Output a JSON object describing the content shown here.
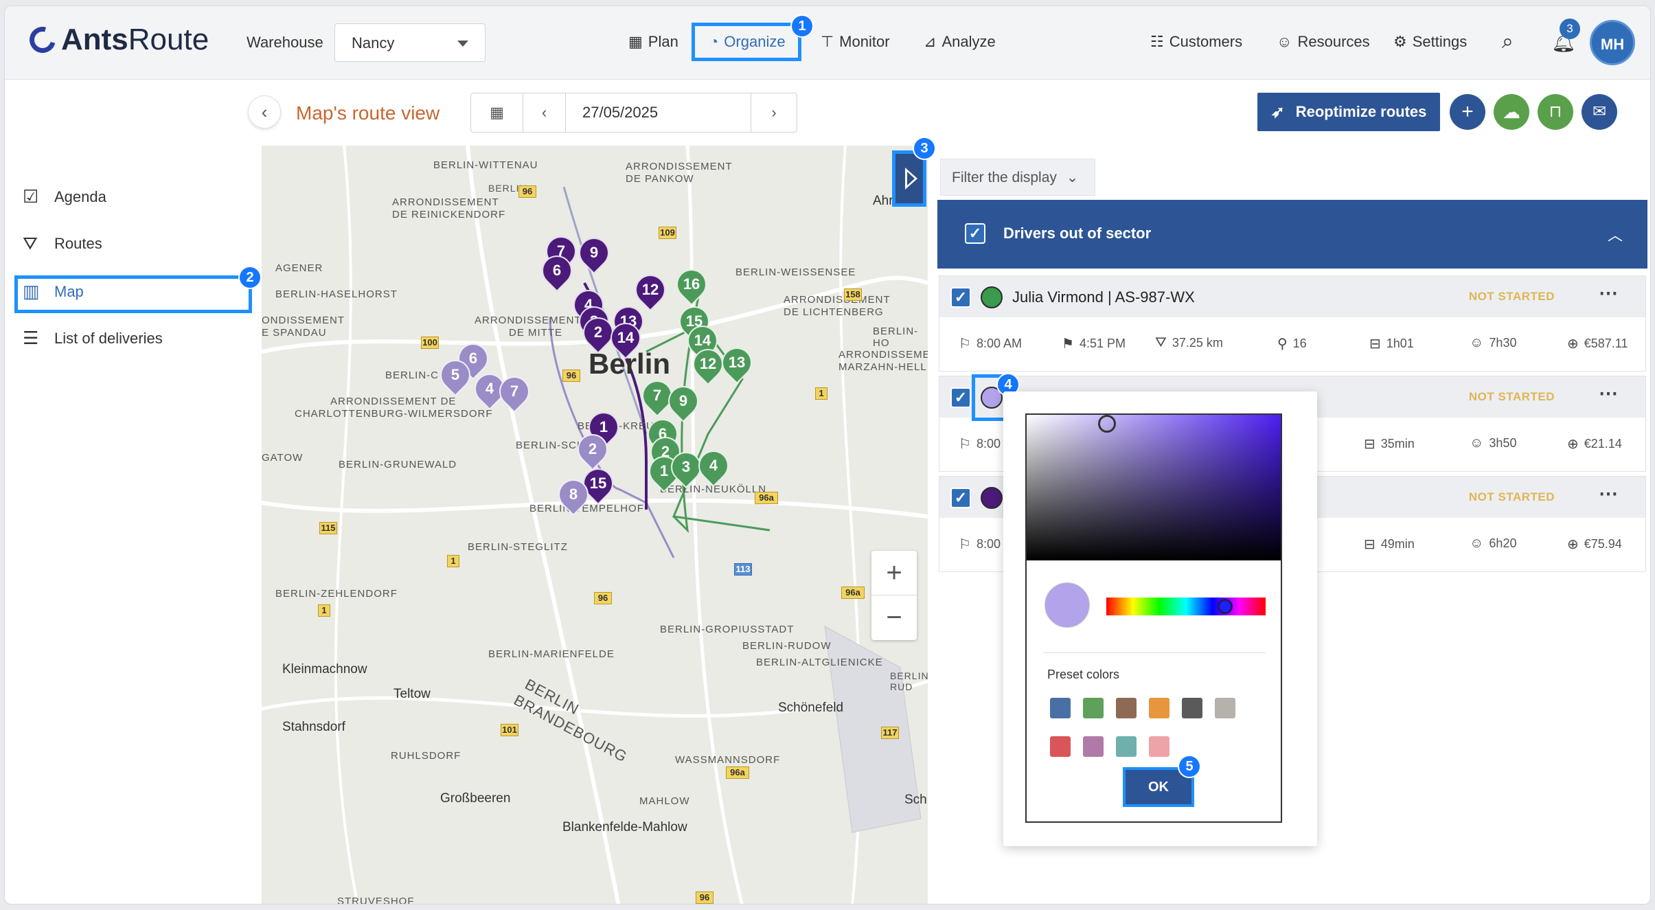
{
  "app": {
    "logo_bold": "Ants",
    "logo_rest": "Route"
  },
  "header": {
    "warehouse_label": "Warehouse",
    "warehouse_value": "Nancy",
    "nav": [
      {
        "label": "Plan",
        "icon": "calendar-icon"
      },
      {
        "label": "Organize",
        "icon": "gauge-icon"
      },
      {
        "label": "Monitor",
        "icon": "signpost-icon"
      },
      {
        "label": "Analyze",
        "icon": "chart-icon"
      },
      {
        "label": "Customers",
        "icon": "people-icon"
      },
      {
        "label": "Resources",
        "icon": "user-gear-icon"
      },
      {
        "label": "Settings",
        "icon": "gear-icon"
      }
    ],
    "notification_count": "3",
    "avatar_initials": "MH"
  },
  "steps": {
    "s1": "1",
    "s2": "2",
    "s3": "3",
    "s4": "4",
    "s5": "5"
  },
  "subheader": {
    "title": "Map's route view",
    "date": "27/05/2025",
    "reoptimize_label": "Reoptimize routes"
  },
  "sidebar": {
    "items": [
      {
        "label": "Agenda",
        "icon": "calendar-check-icon"
      },
      {
        "label": "Routes",
        "icon": "map-fold-icon"
      },
      {
        "label": "Map",
        "icon": "map-icon"
      },
      {
        "label": "List of deliveries",
        "icon": "list-icon"
      }
    ]
  },
  "map": {
    "city": "Berlin",
    "labels": [
      "BERLIN-WITTENAU",
      "ARRONDISSEMENT",
      "DE PANKOW",
      "ARRONDISSEMENT",
      "DE REINICKENDORF",
      "AGENER",
      "BERLIN-HASELHORST",
      "ONDISSEMENT",
      "E SPANDAU",
      "BERLIN-C",
      "ARRONDISSEMENT DE",
      "CHARLOTTENBURG-WILMERSDORF",
      "GATOW",
      "BERLIN-GRUNEWALD",
      "BERLIN-SCHÖN",
      "BERLIN-KREU",
      "BERLIN-NEUKÖLLN",
      "BERLIN-TEMPELHOF",
      "BERLIN-STEGLITZ",
      "BERLIN-ZEHLENDORF",
      "BERLIN-MARIENFELDE",
      "BERLIN-GROPIUSSTADT",
      "BERLIN-RUDOW",
      "BERLIN-ALTGLIENICKE",
      "Kleinmachnow",
      "Teltow",
      "Stahnsdorf",
      "RUHLSDORF",
      "BERLIN",
      "BRANDEBOURG",
      "Schönefeld",
      "WASSMANNSDORF",
      "MAHLOW",
      "Großbeeren",
      "Blankenfelde-Mahlow",
      "STRUVESHOF",
      "BERLIN-WEISSENSEE",
      "ARRONDISSEMENT",
      "DE LICHTENBERG",
      "BERLIN-HO",
      "ARRONDISSEMENT",
      "MARZAHN-HELL",
      "ARRONDISSEMENT",
      "DE MITTE",
      "Ahr",
      "Schu",
      "BERLIN",
      "BERLIN-RUD"
    ],
    "shields": [
      "96",
      "109",
      "158",
      "100",
      "96",
      "1",
      "115",
      "1",
      "96a",
      "113",
      "1",
      "96",
      "96a",
      "101",
      "96a",
      "117",
      "96"
    ],
    "purple_dark_pins": [
      "7",
      "9",
      "6",
      "12",
      "4",
      "3",
      "13",
      "2",
      "14",
      "1",
      "15"
    ],
    "purple_light_pins": [
      "6",
      "5",
      "4",
      "7",
      "2",
      "8"
    ],
    "green_pins": [
      "16",
      "15",
      "14",
      "12",
      "13",
      "7",
      "9",
      "6",
      "2",
      "1",
      "3",
      "4"
    ]
  },
  "panel": {
    "filter_label": "Filter the display",
    "sector_title": "Drivers out of sector",
    "routes": [
      {
        "name": "Julia Virmond | AS-987-WX",
        "status": "NOT STARTED",
        "color": "#3a9a4e",
        "stats": [
          "8:00 AM",
          "4:51 PM",
          "37.25 km",
          "16",
          "1h01",
          "7h30",
          "€587.11"
        ]
      },
      {
        "name": "",
        "status": "NOT STARTED",
        "color": "#b2a3ea",
        "stats": [
          "8:00",
          "35min",
          "3h50",
          "€21.14"
        ]
      },
      {
        "name": "",
        "status": "NOT STARTED",
        "color": "#4b1a7a",
        "stats": [
          "8:00",
          "49min",
          "6h20",
          "€75.94"
        ]
      }
    ]
  },
  "color_picker": {
    "preset_label": "Preset colors",
    "presets": [
      "#4a6fa5",
      "#5fa05a",
      "#8e6a55",
      "#e8963d",
      "#5a5a5a",
      "#b5b1ab",
      "#d9555a",
      "#b07aa8",
      "#6fb0ad",
      "#eea3a8"
    ],
    "ok_label": "OK",
    "selected_color": "#b2a3ea"
  },
  "colors": {
    "accent_blue": "#2d5596",
    "highlight_blue": "#1e90ff",
    "title_orange": "#c8662f",
    "route_dark_purple": "#4b1a7a",
    "route_light_purple": "#9b8cc8",
    "route_green": "#4c9a5a"
  }
}
